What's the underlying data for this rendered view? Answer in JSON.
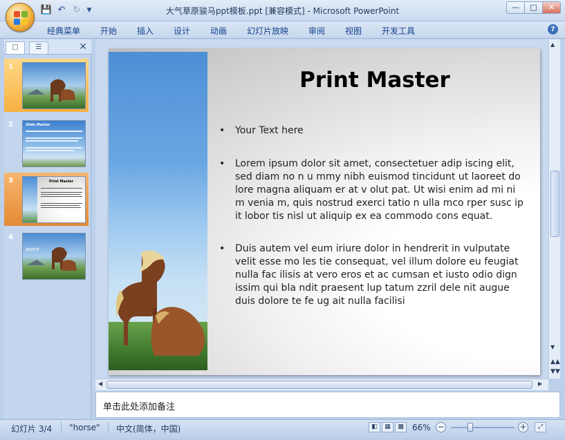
{
  "window": {
    "title": "大气草原骏马ppt模板.ppt [兼容模式] - Microsoft PowerPoint",
    "controls": [
      "—",
      "□",
      "✕"
    ]
  },
  "qat": {
    "save_icon": "save-icon",
    "undo_icon": "undo-icon",
    "redo_icon": "redo-icon",
    "customize_icon": "customize-icon"
  },
  "ribbon": {
    "tabs": [
      "经典菜单",
      "开始",
      "插入",
      "设计",
      "动画",
      "幻灯片放映",
      "审阅",
      "视图",
      "开发工具"
    ],
    "help": "?"
  },
  "panel": {
    "close": "✕",
    "slides": [
      {
        "num": "1",
        "title": ""
      },
      {
        "num": "2",
        "title": "Slide Master"
      },
      {
        "num": "3",
        "title": "Print Master"
      },
      {
        "num": "4",
        "title": "谢谢欣赏"
      }
    ]
  },
  "slide": {
    "title": "Print Master",
    "bullets": [
      "Your Text here",
      "Lorem ipsum dolor sit amet, consectetuer adip iscing elit, sed diam no n u mmy nibh euismod tincidunt ut laoreet do lore magna aliquam er at v olut pat. Ut wisi enim ad mi ni m venia m, quis nostrud exerci tatio n ulla mco rper susc ip it lobor tis nisl ut aliquip ex ea commodo cons equat.",
      "Duis autem vel eum iriure dolor in hendrerit in vulputate velit esse mo les tie consequat, vel illum dolore eu feugiat nulla fac ilisis at vero eros et ac cumsan et iusto odio dign issim qui bla ndit praesent lup tatum zzril dele nit augue duis dolore te fe ug ait nulla facilisi"
    ]
  },
  "notes": {
    "placeholder": "单击此处添加备注"
  },
  "status": {
    "slide_counter": "幻灯片 3/4",
    "theme": "\"horse\"",
    "language": "中文(简体，中国)",
    "zoom": "66%",
    "zoom_minus": "−",
    "zoom_plus": "+"
  }
}
